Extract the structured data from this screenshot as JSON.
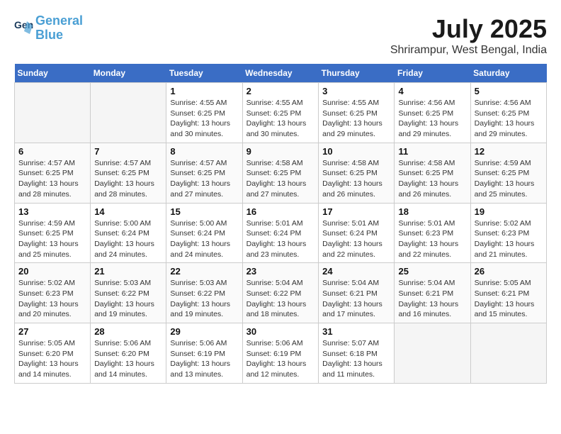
{
  "header": {
    "logo_line1": "General",
    "logo_line2": "Blue",
    "month_title": "July 2025",
    "location": "Shrirampur, West Bengal, India"
  },
  "weekdays": [
    "Sunday",
    "Monday",
    "Tuesday",
    "Wednesday",
    "Thursday",
    "Friday",
    "Saturday"
  ],
  "weeks": [
    [
      {
        "day": "",
        "empty": true
      },
      {
        "day": "",
        "empty": true
      },
      {
        "day": "1",
        "sunrise": "4:55 AM",
        "sunset": "6:25 PM",
        "daylight": "13 hours and 30 minutes."
      },
      {
        "day": "2",
        "sunrise": "4:55 AM",
        "sunset": "6:25 PM",
        "daylight": "13 hours and 30 minutes."
      },
      {
        "day": "3",
        "sunrise": "4:55 AM",
        "sunset": "6:25 PM",
        "daylight": "13 hours and 29 minutes."
      },
      {
        "day": "4",
        "sunrise": "4:56 AM",
        "sunset": "6:25 PM",
        "daylight": "13 hours and 29 minutes."
      },
      {
        "day": "5",
        "sunrise": "4:56 AM",
        "sunset": "6:25 PM",
        "daylight": "13 hours and 29 minutes."
      }
    ],
    [
      {
        "day": "6",
        "sunrise": "4:57 AM",
        "sunset": "6:25 PM",
        "daylight": "13 hours and 28 minutes."
      },
      {
        "day": "7",
        "sunrise": "4:57 AM",
        "sunset": "6:25 PM",
        "daylight": "13 hours and 28 minutes."
      },
      {
        "day": "8",
        "sunrise": "4:57 AM",
        "sunset": "6:25 PM",
        "daylight": "13 hours and 27 minutes."
      },
      {
        "day": "9",
        "sunrise": "4:58 AM",
        "sunset": "6:25 PM",
        "daylight": "13 hours and 27 minutes."
      },
      {
        "day": "10",
        "sunrise": "4:58 AM",
        "sunset": "6:25 PM",
        "daylight": "13 hours and 26 minutes."
      },
      {
        "day": "11",
        "sunrise": "4:58 AM",
        "sunset": "6:25 PM",
        "daylight": "13 hours and 26 minutes."
      },
      {
        "day": "12",
        "sunrise": "4:59 AM",
        "sunset": "6:25 PM",
        "daylight": "13 hours and 25 minutes."
      }
    ],
    [
      {
        "day": "13",
        "sunrise": "4:59 AM",
        "sunset": "6:25 PM",
        "daylight": "13 hours and 25 minutes."
      },
      {
        "day": "14",
        "sunrise": "5:00 AM",
        "sunset": "6:24 PM",
        "daylight": "13 hours and 24 minutes."
      },
      {
        "day": "15",
        "sunrise": "5:00 AM",
        "sunset": "6:24 PM",
        "daylight": "13 hours and 24 minutes."
      },
      {
        "day": "16",
        "sunrise": "5:01 AM",
        "sunset": "6:24 PM",
        "daylight": "13 hours and 23 minutes."
      },
      {
        "day": "17",
        "sunrise": "5:01 AM",
        "sunset": "6:24 PM",
        "daylight": "13 hours and 22 minutes."
      },
      {
        "day": "18",
        "sunrise": "5:01 AM",
        "sunset": "6:23 PM",
        "daylight": "13 hours and 22 minutes."
      },
      {
        "day": "19",
        "sunrise": "5:02 AM",
        "sunset": "6:23 PM",
        "daylight": "13 hours and 21 minutes."
      }
    ],
    [
      {
        "day": "20",
        "sunrise": "5:02 AM",
        "sunset": "6:23 PM",
        "daylight": "13 hours and 20 minutes."
      },
      {
        "day": "21",
        "sunrise": "5:03 AM",
        "sunset": "6:22 PM",
        "daylight": "13 hours and 19 minutes."
      },
      {
        "day": "22",
        "sunrise": "5:03 AM",
        "sunset": "6:22 PM",
        "daylight": "13 hours and 19 minutes."
      },
      {
        "day": "23",
        "sunrise": "5:04 AM",
        "sunset": "6:22 PM",
        "daylight": "13 hours and 18 minutes."
      },
      {
        "day": "24",
        "sunrise": "5:04 AM",
        "sunset": "6:21 PM",
        "daylight": "13 hours and 17 minutes."
      },
      {
        "day": "25",
        "sunrise": "5:04 AM",
        "sunset": "6:21 PM",
        "daylight": "13 hours and 16 minutes."
      },
      {
        "day": "26",
        "sunrise": "5:05 AM",
        "sunset": "6:21 PM",
        "daylight": "13 hours and 15 minutes."
      }
    ],
    [
      {
        "day": "27",
        "sunrise": "5:05 AM",
        "sunset": "6:20 PM",
        "daylight": "13 hours and 14 minutes."
      },
      {
        "day": "28",
        "sunrise": "5:06 AM",
        "sunset": "6:20 PM",
        "daylight": "13 hours and 14 minutes."
      },
      {
        "day": "29",
        "sunrise": "5:06 AM",
        "sunset": "6:19 PM",
        "daylight": "13 hours and 13 minutes."
      },
      {
        "day": "30",
        "sunrise": "5:06 AM",
        "sunset": "6:19 PM",
        "daylight": "13 hours and 12 minutes."
      },
      {
        "day": "31",
        "sunrise": "5:07 AM",
        "sunset": "6:18 PM",
        "daylight": "13 hours and 11 minutes."
      },
      {
        "day": "",
        "empty": true
      },
      {
        "day": "",
        "empty": true
      }
    ]
  ]
}
